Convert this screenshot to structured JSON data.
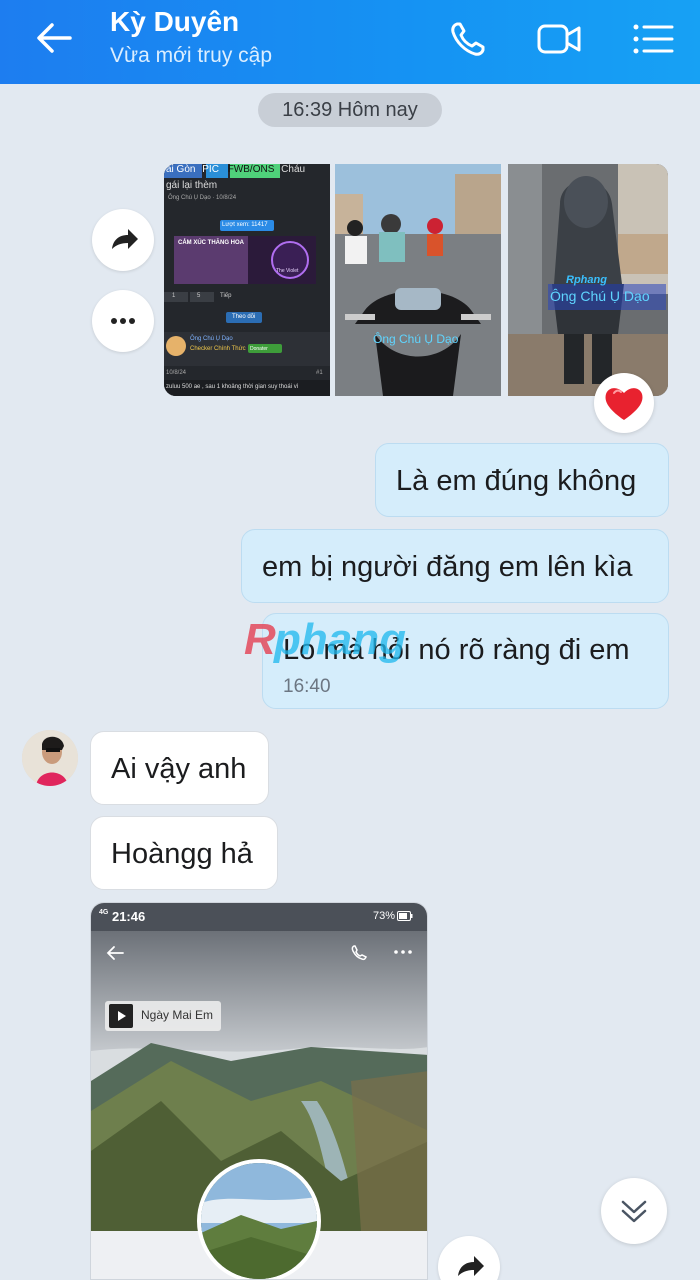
{
  "header": {
    "title": "Kỳ Duyên",
    "subtitle": "Vừa mới truy cập"
  },
  "time_divider": "16:39 Hôm nay",
  "forwarded_photos": {
    "photo1": {
      "tags": [
        "ai Gòn",
        "PIC",
        "FWB/ONS",
        "Cháu"
      ],
      "line2": "gái lại thèm",
      "author": "Ông Chú Ụ Dạo · 10/8/24",
      "views": "Lượt xem: 11417",
      "banner": "CẢM XÚC THĂNG HOA",
      "banner_brand": "The Violet",
      "follow": "Theo dõi",
      "page_next": "Tiếp",
      "pages": [
        "1",
        "5"
      ],
      "poster": "Ông Chú Ụ Dạo",
      "poster_badge": "Checker Chính Thức",
      "donate": "Donater",
      "date": "10/8/24",
      "post_num": "#1",
      "snippet": "zuluu 500 ae , sau 1 khoảng thời gian suy thoái vì"
    },
    "photo2": {
      "watermark": "Ông Chú Ụ Dạo"
    },
    "photo3": {
      "watermark": "Ông Chú Ụ Dạo",
      "brand": "Rphang"
    }
  },
  "messages": {
    "out1": "Là em đúng không",
    "out2": "em bị người đăng em lên kìa",
    "out3": "Lo mà hỏi nó rõ ràng đi em",
    "out3_time": "16:40",
    "in1": "Ai vậy anh",
    "in2": "Hoàngg hả"
  },
  "watermark_text": "Rphang",
  "shared_screenshot": {
    "status_time": "21:46",
    "status_signal": "4G",
    "status_battery": "73%",
    "music_label": "Ngày Mai Em"
  },
  "icons": [
    "back-arrow-icon",
    "phone-icon",
    "video-icon",
    "list-menu-icon",
    "share-icon",
    "more-icon",
    "heart-icon",
    "chevron-double-down-icon"
  ],
  "colors": {
    "header": "#1a88f1",
    "outgoing": "#d5edfb",
    "incoming": "#ffffff",
    "background": "#e2e9f1"
  }
}
